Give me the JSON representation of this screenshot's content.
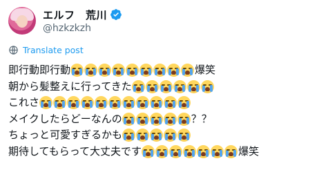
{
  "author": {
    "display_name": "エルフ　荒川",
    "handle": "@hzkzkzh",
    "verified": true
  },
  "translate_label": "Translate post",
  "emoji": "loudly-crying-face",
  "tweet_lines": [
    {
      "text_before": "即行動即行動",
      "emoji_count": 9,
      "text_after": "爆笑"
    },
    {
      "text_before": "朝から髪整えに行ってきた",
      "emoji_count": 6,
      "text_after": ""
    },
    {
      "text_before": "これさ",
      "emoji_count": 11,
      "text_after": ""
    },
    {
      "text_before": "メイクしたらどーなんの",
      "emoji_count": 5,
      "text_after": "？？"
    },
    {
      "text_before": "ちょっと可愛すぎるかも",
      "emoji_count": 5,
      "text_after": ""
    },
    {
      "text_before": "期待してもらって大丈夫です",
      "emoji_count": 7,
      "text_after": "爆笑"
    }
  ],
  "colors": {
    "link_blue": "#1d9bf0",
    "secondary_text": "#536471",
    "primary_text": "#0f1419"
  }
}
